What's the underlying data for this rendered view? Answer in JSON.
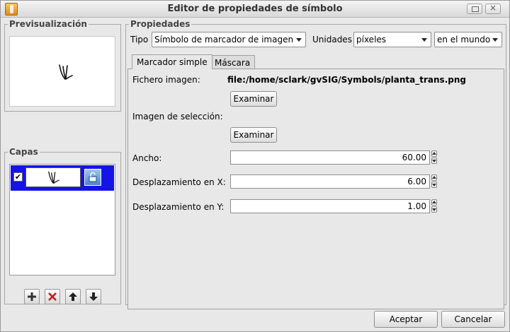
{
  "window": {
    "title": "Editor de propiedades de símbolo",
    "app_icon": "gvsig-app-icon"
  },
  "preview": {
    "legend": "Previsualización"
  },
  "layers": {
    "legend": "Capas",
    "items": [
      {
        "checked": true,
        "check_glyph": "✔"
      }
    ],
    "toolbar": {
      "add_icon": "plus-icon",
      "remove_icon": "red-x-icon",
      "up_icon": "arrow-up-icon",
      "down_icon": "arrow-down-icon"
    }
  },
  "properties": {
    "legend": "Propiedades",
    "type_label": "Tipo",
    "type_value": "Símbolo de marcador de imagen",
    "units_label": "Unidades",
    "units_value": "píxeles",
    "reference_value": "en el mundo"
  },
  "tabs": [
    {
      "label": "Marcador simple",
      "active": true
    },
    {
      "label": "Máscara",
      "active": false
    }
  ],
  "simple_marker": {
    "image_file_label": "Fichero imagen:",
    "image_file_value": "file:/home/sclark/gvSIG/Symbols/planta_trans.png",
    "browse_button": "Examinar",
    "selection_image_label": "Imagen de selección:",
    "selection_browse_button": "Examinar",
    "width_label": "Ancho:",
    "width_value": "60.00",
    "offset_x_label": "Desplazamiento en X:",
    "offset_x_value": "6.00",
    "offset_y_label": "Desplazamiento en Y:",
    "offset_y_value": "1.00"
  },
  "footer": {
    "accept_button": "Aceptar",
    "cancel_button": "Cancelar"
  },
  "colors": {
    "selection": "#1414e6",
    "remove_icon": "#d01818"
  }
}
